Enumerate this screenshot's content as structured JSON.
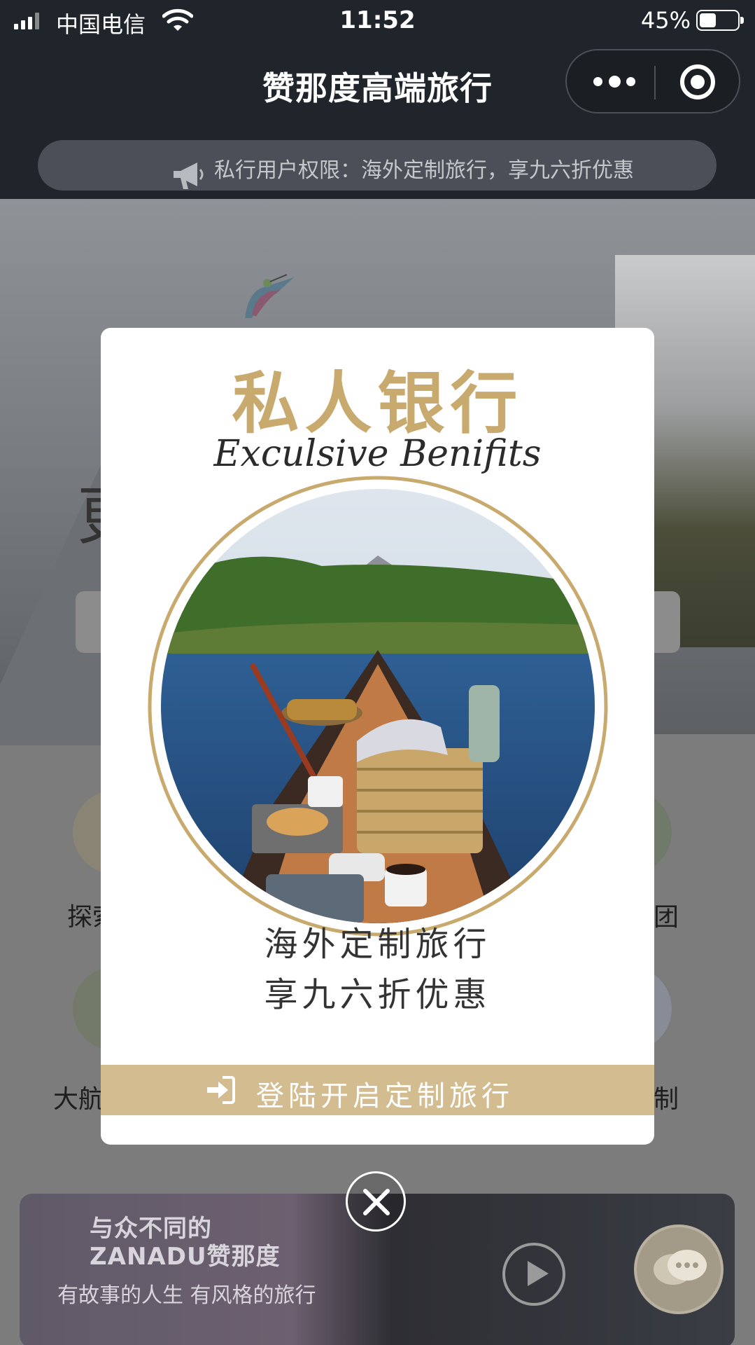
{
  "status_bar": {
    "carrier": "中国电信",
    "time": "11:52",
    "battery": "45%",
    "battery_level": 0.45
  },
  "nav": {
    "title": "赞那度高端旅行"
  },
  "notice": {
    "text": "私行用户权限：海外定制旅行，享九六折优惠"
  },
  "background": {
    "hero_char": "更",
    "categories": [
      {
        "label": "探索"
      },
      {
        "label": "团"
      },
      {
        "label": "大航"
      },
      {
        "label": "制"
      }
    ],
    "banner": {
      "brand_line1": "与众不同的",
      "brand_line2": "ZANADU赞那度",
      "slogan": "有故事的人生 有风格的旅行"
    }
  },
  "modal": {
    "title": "私人银行",
    "subtitle": "Exculsive Benifits",
    "line1": "海外定制旅行",
    "line2": "享九六折优惠",
    "login_label": "登陆开启定制旅行"
  },
  "colors": {
    "gold": "#c8aa6e",
    "gold_bar": "#d3bd90",
    "nav_bg": "#20252b"
  }
}
